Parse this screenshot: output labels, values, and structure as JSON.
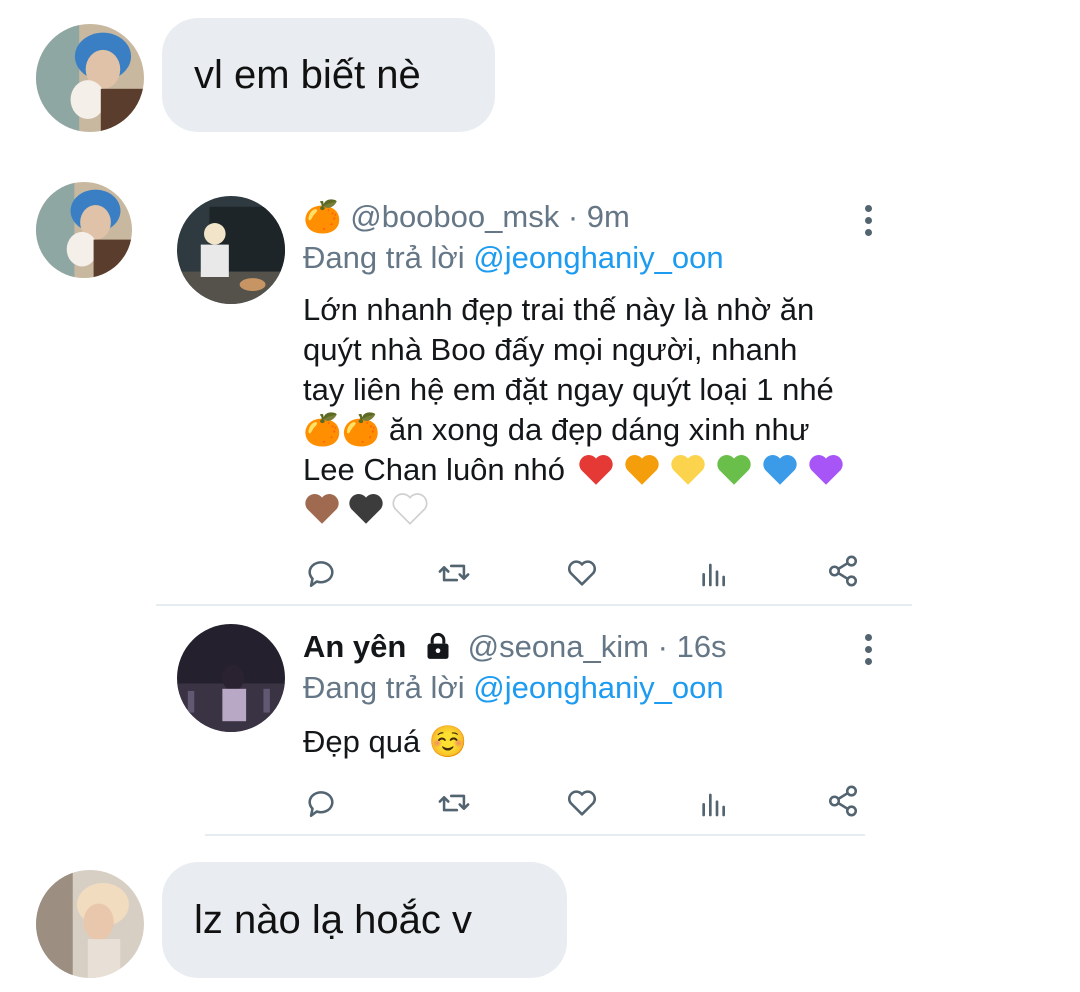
{
  "messages": [
    {
      "text": "vl em biết nè"
    },
    {
      "text": "lz nào lạ hoắc v"
    }
  ],
  "tweets": [
    {
      "display_name": "",
      "name_emoji": "🍊",
      "handle": "@booboo_msk",
      "separator": "·",
      "time": "9m",
      "reply_prefix": "Đang trả lời",
      "reply_to": "@jeonghaniy_oon",
      "lines": [
        "Lớn nhanh đẹp trai thế này là nhờ ăn",
        "quýt nhà Boo đấy mọi người, nhanh",
        "tay liên hệ em đặt ngay quýt loại 1 nhé",
        "ăn xong da đẹp dáng xinh như",
        "Lee Chan luôn nhó"
      ],
      "emoji_orange": "🍊🍊",
      "hearts_line1": [
        "red-heart",
        "orange-heart",
        "yellow-heart",
        "green-heart",
        "blue-heart",
        "purple-heart"
      ],
      "hearts_line2": [
        "brown-heart",
        "black-heart",
        "white-heart"
      ]
    },
    {
      "display_name": "An yên",
      "lock_icon": "lock-icon",
      "handle": "@seona_kim",
      "separator": "·",
      "time": "16s",
      "reply_prefix": "Đang trả lời",
      "reply_to": "@jeonghaniy_oon",
      "lines": [
        "Đẹp quá"
      ],
      "emoji_smile": "☺️"
    }
  ],
  "action_icons": [
    "reply-icon",
    "retweet-icon",
    "like-icon",
    "analytics-icon",
    "share-icon"
  ],
  "colors": {
    "bubble": "#e9edf2",
    "link": "#1d9bf0",
    "muted": "#657786",
    "divider": "#e6ecf0"
  }
}
